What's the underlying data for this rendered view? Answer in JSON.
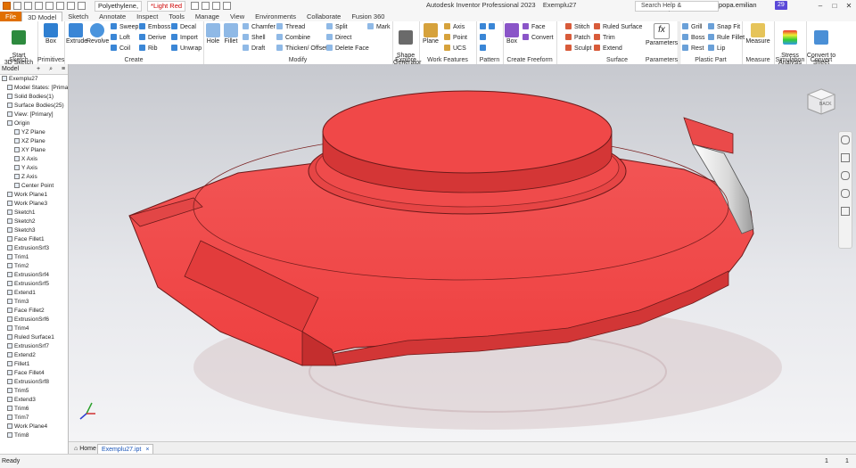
{
  "app": {
    "title": "Autodesk Inventor Professional 2023",
    "document": "Exemplu27",
    "material": "Polyethylene,",
    "appearance": "*Light Red",
    "search_placeholder": "Search Help & Commands...",
    "user": "popa.emilian",
    "notification_count": "29"
  },
  "tabs": [
    {
      "label": "File"
    },
    {
      "label": "3D Model"
    },
    {
      "label": "Sketch"
    },
    {
      "label": "Annotate"
    },
    {
      "label": "Inspect"
    },
    {
      "label": "Tools"
    },
    {
      "label": "Manage"
    },
    {
      "label": "View"
    },
    {
      "label": "Environments"
    },
    {
      "label": "Collaborate"
    },
    {
      "label": "Fusion 360"
    }
  ],
  "ribbon": {
    "sketch": {
      "label": "Sketch",
      "start": "Start\n3D Sketch"
    },
    "primitives": {
      "label": "Primitives",
      "box": "Box"
    },
    "create": {
      "label": "Create",
      "extrude": "Extrude",
      "revolve": "Revolve",
      "sweep": "Sweep",
      "loft": "Loft",
      "coil": "Coil",
      "emboss": "Emboss",
      "derive": "Derive",
      "rib": "Rib",
      "decal": "Decal",
      "import": "Import",
      "unwrap": "Unwrap"
    },
    "modify": {
      "label": "Modify",
      "hole": "Hole",
      "fillet": "Fillet",
      "chamfer": "Chamfer",
      "shell": "Shell",
      "draft": "Draft",
      "thread": "Thread",
      "combine": "Combine",
      "thicken": "Thicken/ Offset",
      "split": "Split",
      "direct": "Direct",
      "delete_face": "Delete Face",
      "mark": "Mark"
    },
    "explore": {
      "label": "Explore",
      "shape": "Shape\nGenerator"
    },
    "work": {
      "label": "Work Features",
      "plane": "Plane",
      "axis": "Axis",
      "point": "Point",
      "ucs": "UCS"
    },
    "pattern": {
      "label": "Pattern"
    },
    "freeform": {
      "label": "Create Freeform",
      "box": "Box",
      "face": "Face",
      "convert": "Convert"
    },
    "surface": {
      "label": "Surface",
      "stitch": "Stitch",
      "patch": "Patch",
      "sculpt": "Sculpt",
      "ruled": "Ruled Surface",
      "trim": "Trim",
      "extend": "Extend"
    },
    "parameters": {
      "label": "Parameters",
      "btn": "Parameters"
    },
    "plastic": {
      "label": "Plastic Part",
      "grill": "Grill",
      "boss": "Boss",
      "rest": "Rest",
      "snap": "Snap Fit",
      "rule": "Rule Fillet",
      "lip": "Lip"
    },
    "measure": {
      "label": "Measure",
      "btn": "Measure"
    },
    "simulation": {
      "label": "Simulation",
      "btn": "Stress\nAnalysis"
    },
    "convert": {
      "label": "Convert",
      "btn": "Convert to\nSheet Metal"
    }
  },
  "browser": {
    "title": "Model",
    "items": [
      {
        "label": "Exemplu27"
      },
      {
        "label": "Model States: [Prima"
      },
      {
        "label": "Solid Bodies(1)"
      },
      {
        "label": "Surface Bodies(25)"
      },
      {
        "label": "View: [Primary]"
      },
      {
        "label": "Origin"
      },
      {
        "label": "YZ Plane"
      },
      {
        "label": "XZ Plane"
      },
      {
        "label": "XY Plane"
      },
      {
        "label": "X Axis"
      },
      {
        "label": "Y Axis"
      },
      {
        "label": "Z Axis"
      },
      {
        "label": "Center Point"
      },
      {
        "label": "Work Plane1"
      },
      {
        "label": "Work Plane3"
      },
      {
        "label": "Sketch1"
      },
      {
        "label": "Sketch2"
      },
      {
        "label": "Sketch3"
      },
      {
        "label": "Face Fillet1"
      },
      {
        "label": "ExtrusionSrf3"
      },
      {
        "label": "Trim1"
      },
      {
        "label": "Trim2"
      },
      {
        "label": "ExtrusionSrf4"
      },
      {
        "label": "ExtrusionSrf5"
      },
      {
        "label": "Extend1"
      },
      {
        "label": "Trim3"
      },
      {
        "label": "Face Fillet2"
      },
      {
        "label": "ExtrusionSrf6"
      },
      {
        "label": "Trim4"
      },
      {
        "label": "Ruled Surface1"
      },
      {
        "label": "ExtrusionSrf7"
      },
      {
        "label": "Extend2"
      },
      {
        "label": "Fillet1"
      },
      {
        "label": "Face Fillet4"
      },
      {
        "label": "ExtrusionSrf8"
      },
      {
        "label": "Trim5"
      },
      {
        "label": "Extend3"
      },
      {
        "label": "Trim6"
      },
      {
        "label": "Trim7"
      },
      {
        "label": "Work Plane4"
      },
      {
        "label": "Trim8"
      }
    ]
  },
  "viewcube": {
    "face": "BACK"
  },
  "doc_tabs": [
    {
      "label": "Home"
    },
    {
      "label": "Exemplu27.ipt"
    }
  ],
  "status": {
    "text": "Ready",
    "right1": "1",
    "right2": "1"
  },
  "colors": {
    "accent": "#e06f00",
    "part": "#f04848",
    "part_dark": "#c83232"
  }
}
